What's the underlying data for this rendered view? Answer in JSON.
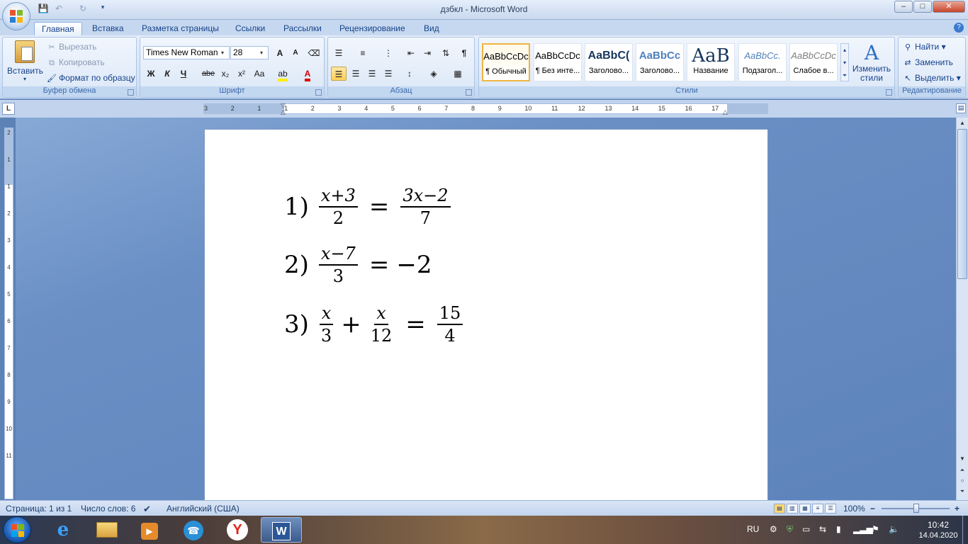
{
  "window": {
    "title": "дзбкл - Microsoft Word",
    "minimize": "–",
    "maximize": "□",
    "close": "✕"
  },
  "tabs": [
    {
      "label": "Главная",
      "active": true
    },
    {
      "label": "Вставка"
    },
    {
      "label": "Разметка страницы"
    },
    {
      "label": "Ссылки"
    },
    {
      "label": "Рассылки"
    },
    {
      "label": "Рецензирование"
    },
    {
      "label": "Вид"
    }
  ],
  "ribbon": {
    "clipboard": {
      "paste": "Вставить",
      "cut": "Вырезать",
      "copy": "Копировать",
      "format_painter": "Формат по образцу",
      "label": "Буфер обмена"
    },
    "font": {
      "family": "Times New Roman",
      "size": "28",
      "label": "Шрифт",
      "bold": "Ж",
      "italic": "К",
      "underline": "Ч",
      "strike": "abe",
      "subscript": "x₂",
      "superscript": "x²",
      "case": "Aa",
      "grow": "A",
      "shrink": "A"
    },
    "paragraph": {
      "label": "Абзац",
      "pilcrow": "¶"
    },
    "styles": {
      "label": "Стили",
      "items": [
        {
          "sample": "AaBbCcDc",
          "name": "¶ Обычный",
          "selected": true
        },
        {
          "sample": "AaBbCcDc",
          "name": "¶ Без инте..."
        },
        {
          "sample": "AaBbC(",
          "name": "Заголово..."
        },
        {
          "sample": "AaBbCc",
          "name": "Заголово..."
        },
        {
          "sample": "AaB",
          "name": "Название"
        },
        {
          "sample": "AaBbCc.",
          "name": "Подзагол..."
        },
        {
          "sample": "AaBbCcDc",
          "name": "Слабое в..."
        }
      ],
      "change": "Изменить",
      "change2": "стили"
    },
    "editing": {
      "find": "Найти",
      "replace": "Заменить",
      "select": "Выделить",
      "label": "Редактирование"
    }
  },
  "ruler": {
    "marks": [
      "3",
      "2",
      "1",
      "1",
      "2",
      "3",
      "4",
      "5",
      "6",
      "7",
      "8",
      "9",
      "10",
      "11",
      "12",
      "13",
      "14",
      "15",
      "16",
      "17"
    ]
  },
  "vruler": {
    "marks": [
      "2",
      "1",
      "1",
      "2",
      "3",
      "4",
      "5",
      "6",
      "7",
      "8",
      "9",
      "10",
      "11"
    ]
  },
  "document": {
    "eq1": {
      "num": "1)",
      "l_num": "x+3",
      "l_den": "2",
      "eq": "=",
      "r_num": "3x−2",
      "r_den": "7"
    },
    "eq2": {
      "num": "2)",
      "l_num": "x−7",
      "l_den": "3",
      "eq": "=",
      "rhs": "−2"
    },
    "eq3": {
      "num": "3)",
      "a_num": "x",
      "a_den": "3",
      "plus": "+",
      "b_num": "x",
      "b_den": "12",
      "eq": "=",
      "r_num": "15",
      "r_den": "4"
    }
  },
  "status": {
    "page": "Страница: 1 из 1",
    "words": "Число слов: 6",
    "language": "Английский (США)",
    "zoom": "100%",
    "zoom_out": "−",
    "zoom_in": "+"
  },
  "taskbar": {
    "lang": "RU",
    "time": "10:42",
    "date": "14.04.2020"
  }
}
